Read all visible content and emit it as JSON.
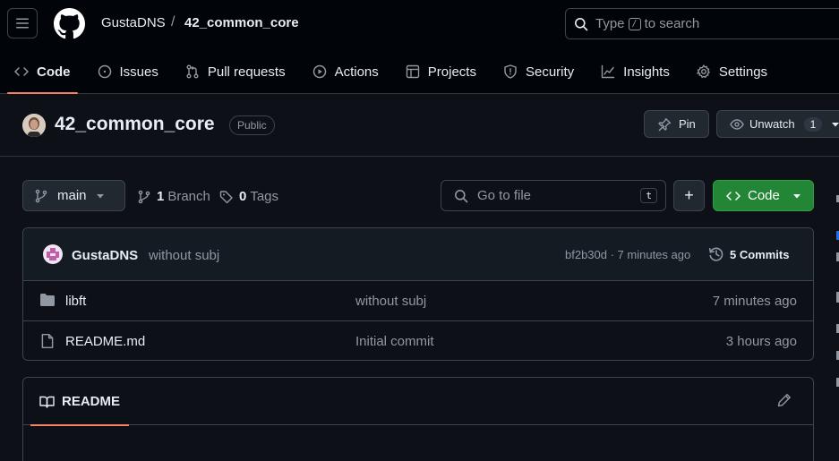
{
  "header": {
    "owner": "GustaDNS",
    "separator": "/",
    "repo": "42_common_core",
    "search": {
      "prefix": "Type",
      "shortcut": "/",
      "suffix": "to search"
    }
  },
  "tabs": [
    {
      "label": "Code",
      "icon": "code-icon",
      "active": true
    },
    {
      "label": "Issues",
      "icon": "issue-icon"
    },
    {
      "label": "Pull requests",
      "icon": "pull-request-icon"
    },
    {
      "label": "Actions",
      "icon": "play-icon"
    },
    {
      "label": "Projects",
      "icon": "table-icon"
    },
    {
      "label": "Security",
      "icon": "shield-icon"
    },
    {
      "label": "Insights",
      "icon": "graph-icon"
    },
    {
      "label": "Settings",
      "icon": "gear-icon"
    }
  ],
  "repo_head": {
    "title": "42_common_core",
    "visibility": "Public",
    "pin_label": "Pin",
    "watch_label": "Unwatch",
    "watch_count": "1"
  },
  "toolbar": {
    "branch": "main",
    "branch_count": "1",
    "branch_label": "Branch",
    "tag_count": "0",
    "tag_label": "Tags",
    "goto_placeholder": "Go to file",
    "goto_shortcut": "t",
    "plus_label": "+",
    "code_label": "Code"
  },
  "latest_commit": {
    "author": "GustaDNS",
    "message": "without subj",
    "hash_time": "bf2b30d · 7 minutes ago",
    "commits_label": "5 Commits"
  },
  "files": [
    {
      "name": "libft",
      "type": "folder",
      "message": "without subj",
      "time": "7 minutes ago"
    },
    {
      "name": "README.md",
      "type": "file",
      "message": "Initial commit",
      "time": "3 hours ago"
    }
  ],
  "readme": {
    "tab_label": "README"
  },
  "colors": {
    "background": "#0d1117",
    "header_bg": "#010409",
    "border": "#3d444d",
    "accent_underline": "#f78166",
    "primary_button": "#238636",
    "muted_text": "#9198a1"
  }
}
